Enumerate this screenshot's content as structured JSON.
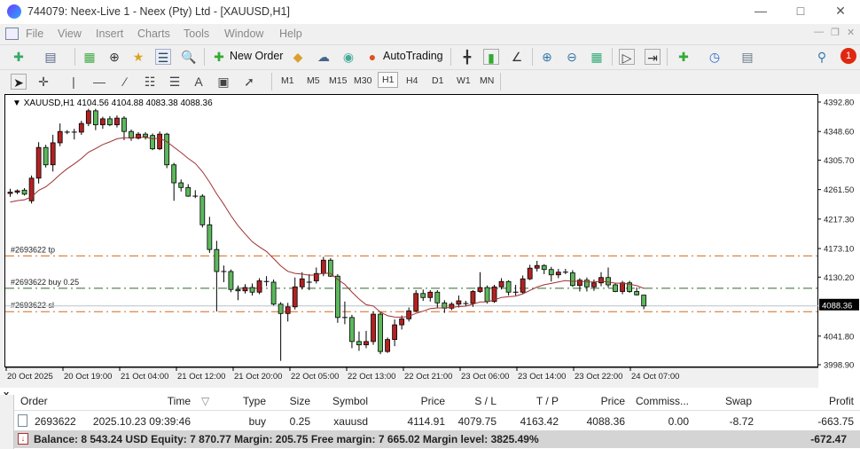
{
  "window": {
    "title": "744079: Neex-Live 1 - Neex (Pty) Ltd - [XAUUSD,H1]"
  },
  "menu": [
    "File",
    "View",
    "Insert",
    "Charts",
    "Tools",
    "Window",
    "Help"
  ],
  "toolbar": {
    "new_order": "New Order",
    "auto_trading": "AutoTrading",
    "notification_count": "1"
  },
  "timeframes": [
    "M1",
    "M5",
    "M15",
    "M30",
    "H1",
    "H4",
    "D1",
    "W1",
    "MN"
  ],
  "active_timeframe": "H1",
  "chart": {
    "info": "XAUUSD,H1  4104.56 4104.88 4083.38 4088.36",
    "bid_label": "4088.36",
    "price_ticks": [
      "4392.80",
      "4348.60",
      "4305.70",
      "4261.50",
      "4217.30",
      "4173.10",
      "4130.20",
      "4088.36",
      "4041.80",
      "3998.90"
    ],
    "tick_values": [
      4392.8,
      4348.6,
      4305.7,
      4261.5,
      4217.3,
      4173.1,
      4130.2,
      4041.8,
      3998.9
    ],
    "time_labels": [
      "20 Oct 2025",
      "20 Oct 19:00",
      "21 Oct 04:00",
      "21 Oct 12:00",
      "21 Oct 20:00",
      "22 Oct 05:00",
      "22 Oct 13:00",
      "22 Oct 21:00",
      "23 Oct 06:00",
      "23 Oct 14:00",
      "23 Oct 22:00",
      "24 Oct 07:00"
    ],
    "levels": [
      {
        "label": "#2693622 tp",
        "price": 4163.42,
        "color": "#d2691e"
      },
      {
        "label": "#2693622 buy 0.25",
        "price": 4114.91,
        "color": "#2e6b2e"
      },
      {
        "label": "#2693622 sl",
        "price": 4079.75,
        "color": "#d2691e"
      }
    ],
    "bid": 4088.36,
    "ylim": [
      3998.9,
      4392.8
    ],
    "up_color": "#b22222",
    "down_color": "#5cb85c",
    "ma_color": "#a03030",
    "ohlc": [
      [
        4257,
        4264,
        4252,
        4259
      ],
      [
        4259,
        4263,
        4256,
        4261
      ],
      [
        4262,
        4265,
        4254,
        4256
      ],
      [
        4246,
        4284,
        4242,
        4280
      ],
      [
        4280,
        4334,
        4272,
        4326
      ],
      [
        4326,
        4330,
        4296,
        4300
      ],
      [
        4300,
        4345,
        4290,
        4333
      ],
      [
        4333,
        4362,
        4328,
        4350
      ],
      [
        4349,
        4352,
        4346,
        4349
      ],
      [
        4349,
        4354,
        4338,
        4349
      ],
      [
        4349,
        4366,
        4345,
        4362
      ],
      [
        4362,
        4384,
        4358,
        4381
      ],
      [
        4381,
        4384,
        4352,
        4360
      ],
      [
        4360,
        4372,
        4354,
        4369
      ],
      [
        4369,
        4373,
        4358,
        4360
      ],
      [
        4360,
        4374,
        4356,
        4370
      ],
      [
        4370,
        4373,
        4337,
        4350
      ],
      [
        4350,
        4353,
        4336,
        4340
      ],
      [
        4340,
        4349,
        4338,
        4346
      ],
      [
        4346,
        4349,
        4338,
        4342
      ],
      [
        4344,
        4347,
        4322,
        4324
      ],
      [
        4324,
        4350,
        4322,
        4346
      ],
      [
        4346,
        4348,
        4295,
        4300
      ],
      [
        4300,
        4303,
        4246,
        4273
      ],
      [
        4273,
        4278,
        4260,
        4266
      ],
      [
        4266,
        4271,
        4252,
        4253
      ],
      [
        4253,
        4262,
        4250,
        4253
      ],
      [
        4253,
        4256,
        4206,
        4210
      ],
      [
        4210,
        4222,
        4168,
        4173
      ],
      [
        4173,
        4186,
        4080,
        4140
      ],
      [
        4140,
        4149,
        4124,
        4140
      ],
      [
        4140,
        4143,
        4109,
        4113
      ],
      [
        4113,
        4119,
        4097,
        4111
      ],
      [
        4111,
        4121,
        4107,
        4116
      ],
      [
        4116,
        4122,
        4104,
        4109
      ],
      [
        4109,
        4130,
        4106,
        4126
      ],
      [
        4125,
        4133,
        4118,
        4125
      ],
      [
        4124,
        4128,
        4089,
        4091
      ],
      [
        4091,
        4094,
        4006,
        4077
      ],
      [
        4077,
        4093,
        4065,
        4087
      ],
      [
        4087,
        4131,
        4083,
        4117
      ],
      [
        4117,
        4139,
        4113,
        4129
      ],
      [
        4124,
        4136,
        4112,
        4124
      ],
      [
        4126,
        4146,
        4122,
        4137
      ],
      [
        4137,
        4162,
        4133,
        4157
      ],
      [
        4157,
        4160,
        4132,
        4133
      ],
      [
        4133,
        4136,
        4063,
        4071
      ],
      [
        4071,
        4095,
        4061,
        4071
      ],
      [
        4071,
        4075,
        4025,
        4035
      ],
      [
        4035,
        4050,
        4021,
        4030
      ],
      [
        4030,
        4051,
        4025,
        4035
      ],
      [
        4035,
        4080,
        4030,
        4076
      ],
      [
        4076,
        4080,
        4016,
        4020
      ],
      [
        4020,
        4041,
        4018,
        4038
      ],
      [
        4038,
        4068,
        4028,
        4060
      ],
      [
        4060,
        4074,
        4053,
        4069
      ],
      [
        4069,
        4086,
        4065,
        4081
      ],
      [
        4081,
        4112,
        4079,
        4107
      ],
      [
        4107,
        4113,
        4096,
        4101
      ],
      [
        4101,
        4112,
        4095,
        4109
      ],
      [
        4109,
        4112,
        4086,
        4093
      ],
      [
        4093,
        4097,
        4078,
        4085
      ],
      [
        4085,
        4094,
        4082,
        4091
      ],
      [
        4091,
        4104,
        4086,
        4096
      ],
      [
        4092,
        4096,
        4088,
        4092
      ],
      [
        4092,
        4112,
        4087,
        4110
      ],
      [
        4110,
        4139,
        4108,
        4116
      ],
      [
        4116,
        4119,
        4092,
        4095
      ],
      [
        4095,
        4120,
        4093,
        4117
      ],
      [
        4117,
        4130,
        4113,
        4125
      ],
      [
        4125,
        4127,
        4104,
        4109
      ],
      [
        4109,
        4120,
        4104,
        4109
      ],
      [
        4109,
        4134,
        4106,
        4129
      ],
      [
        4129,
        4150,
        4127,
        4145
      ],
      [
        4145,
        4156,
        4140,
        4149
      ],
      [
        4149,
        4151,
        4136,
        4143
      ],
      [
        4143,
        4147,
        4125,
        4135
      ],
      [
        4135,
        4144,
        4130,
        4139
      ],
      [
        4139,
        4144,
        4136,
        4139
      ],
      [
        4138,
        4142,
        4117,
        4119
      ],
      [
        4119,
        4130,
        4110,
        4127
      ],
      [
        4127,
        4131,
        4110,
        4117
      ],
      [
        4117,
        4128,
        4111,
        4123
      ],
      [
        4123,
        4139,
        4118,
        4131
      ],
      [
        4131,
        4146,
        4116,
        4120
      ],
      [
        4120,
        4123,
        4109,
        4110
      ],
      [
        4110,
        4126,
        4106,
        4123
      ],
      [
        4123,
        4126,
        4108,
        4110
      ],
      [
        4110,
        4116,
        4104,
        4105
      ],
      [
        4104.56,
        4104.88,
        4083.38,
        4088.36
      ]
    ]
  },
  "terminal": {
    "headers": [
      "Order",
      "Time",
      "Type",
      "Size",
      "Symbol",
      "Price",
      "S / L",
      "T / P",
      "Price",
      "Commiss...",
      "Swap",
      "Profit"
    ],
    "rows": [
      [
        "2693622",
        "2025.10.23 09:39:46",
        "buy",
        "0.25",
        "xauusd",
        "4114.91",
        "4079.75",
        "4163.42",
        "4088.36",
        "0.00",
        "-8.72",
        "-663.75"
      ]
    ],
    "balance_line": "Balance: 8 543.24 USD  Equity: 7 870.77  Margin: 205.75  Free margin: 7 665.02  Margin level: 3825.49%",
    "total_profit": "-672.47"
  }
}
